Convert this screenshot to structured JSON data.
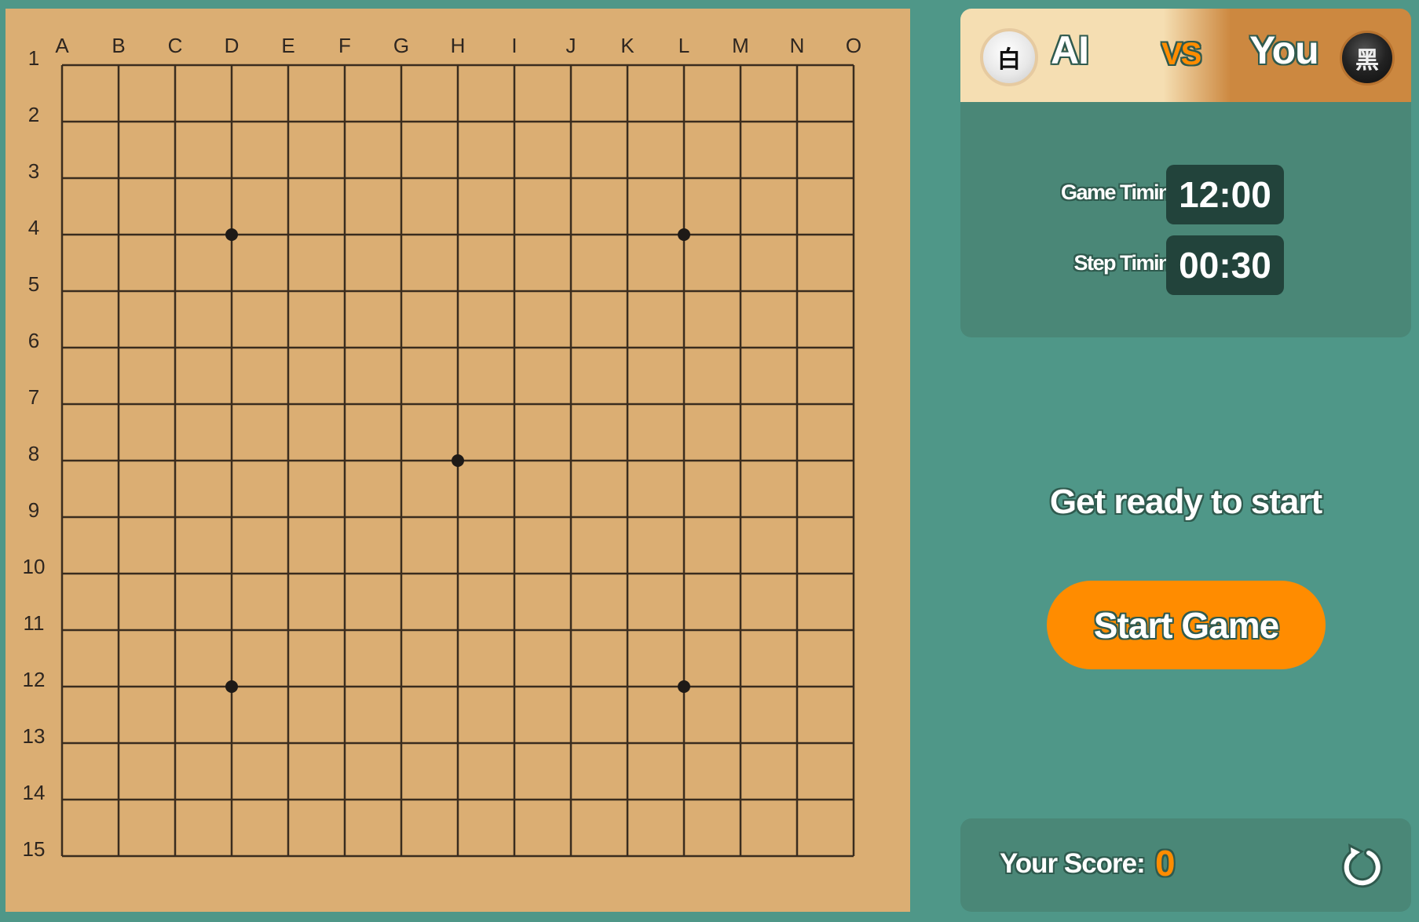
{
  "board": {
    "size": 15,
    "columns": [
      "A",
      "B",
      "C",
      "D",
      "E",
      "F",
      "G",
      "H",
      "I",
      "J",
      "K",
      "L",
      "M",
      "N",
      "O"
    ],
    "rows": [
      "1",
      "2",
      "3",
      "4",
      "5",
      "6",
      "7",
      "8",
      "9",
      "10",
      "11",
      "12",
      "13",
      "14",
      "15"
    ],
    "star_points": [
      {
        "col": "D",
        "row": "4"
      },
      {
        "col": "L",
        "row": "4"
      },
      {
        "col": "H",
        "row": "8"
      },
      {
        "col": "D",
        "row": "12"
      },
      {
        "col": "L",
        "row": "12"
      }
    ],
    "stones": [],
    "colors": {
      "background": "#dbae73",
      "lines": "#3a2c1e",
      "star": "#1e1a17"
    }
  },
  "header": {
    "ai": {
      "name": "AI",
      "stone_glyph": "白",
      "stone_color": "white",
      "icon": "white-stone-icon"
    },
    "vs_label": "VS",
    "player": {
      "name": "You",
      "stone_glyph": "黑",
      "stone_color": "black",
      "icon": "black-stone-icon"
    }
  },
  "timing": {
    "game": {
      "label": "Game Timing",
      "value": "12:00"
    },
    "step": {
      "label": "Step Timing",
      "value": "00:30"
    }
  },
  "status": {
    "text": "Get ready to start"
  },
  "start_button": {
    "label": "Start Game"
  },
  "score": {
    "label": "Your Score:",
    "value": "0",
    "restart_icon": "restart-icon"
  },
  "theme": {
    "page_bg": "#4f9788",
    "panel_bg": "#4a8777",
    "accent": "#ff8c00",
    "timer_bg": "#22433b"
  }
}
